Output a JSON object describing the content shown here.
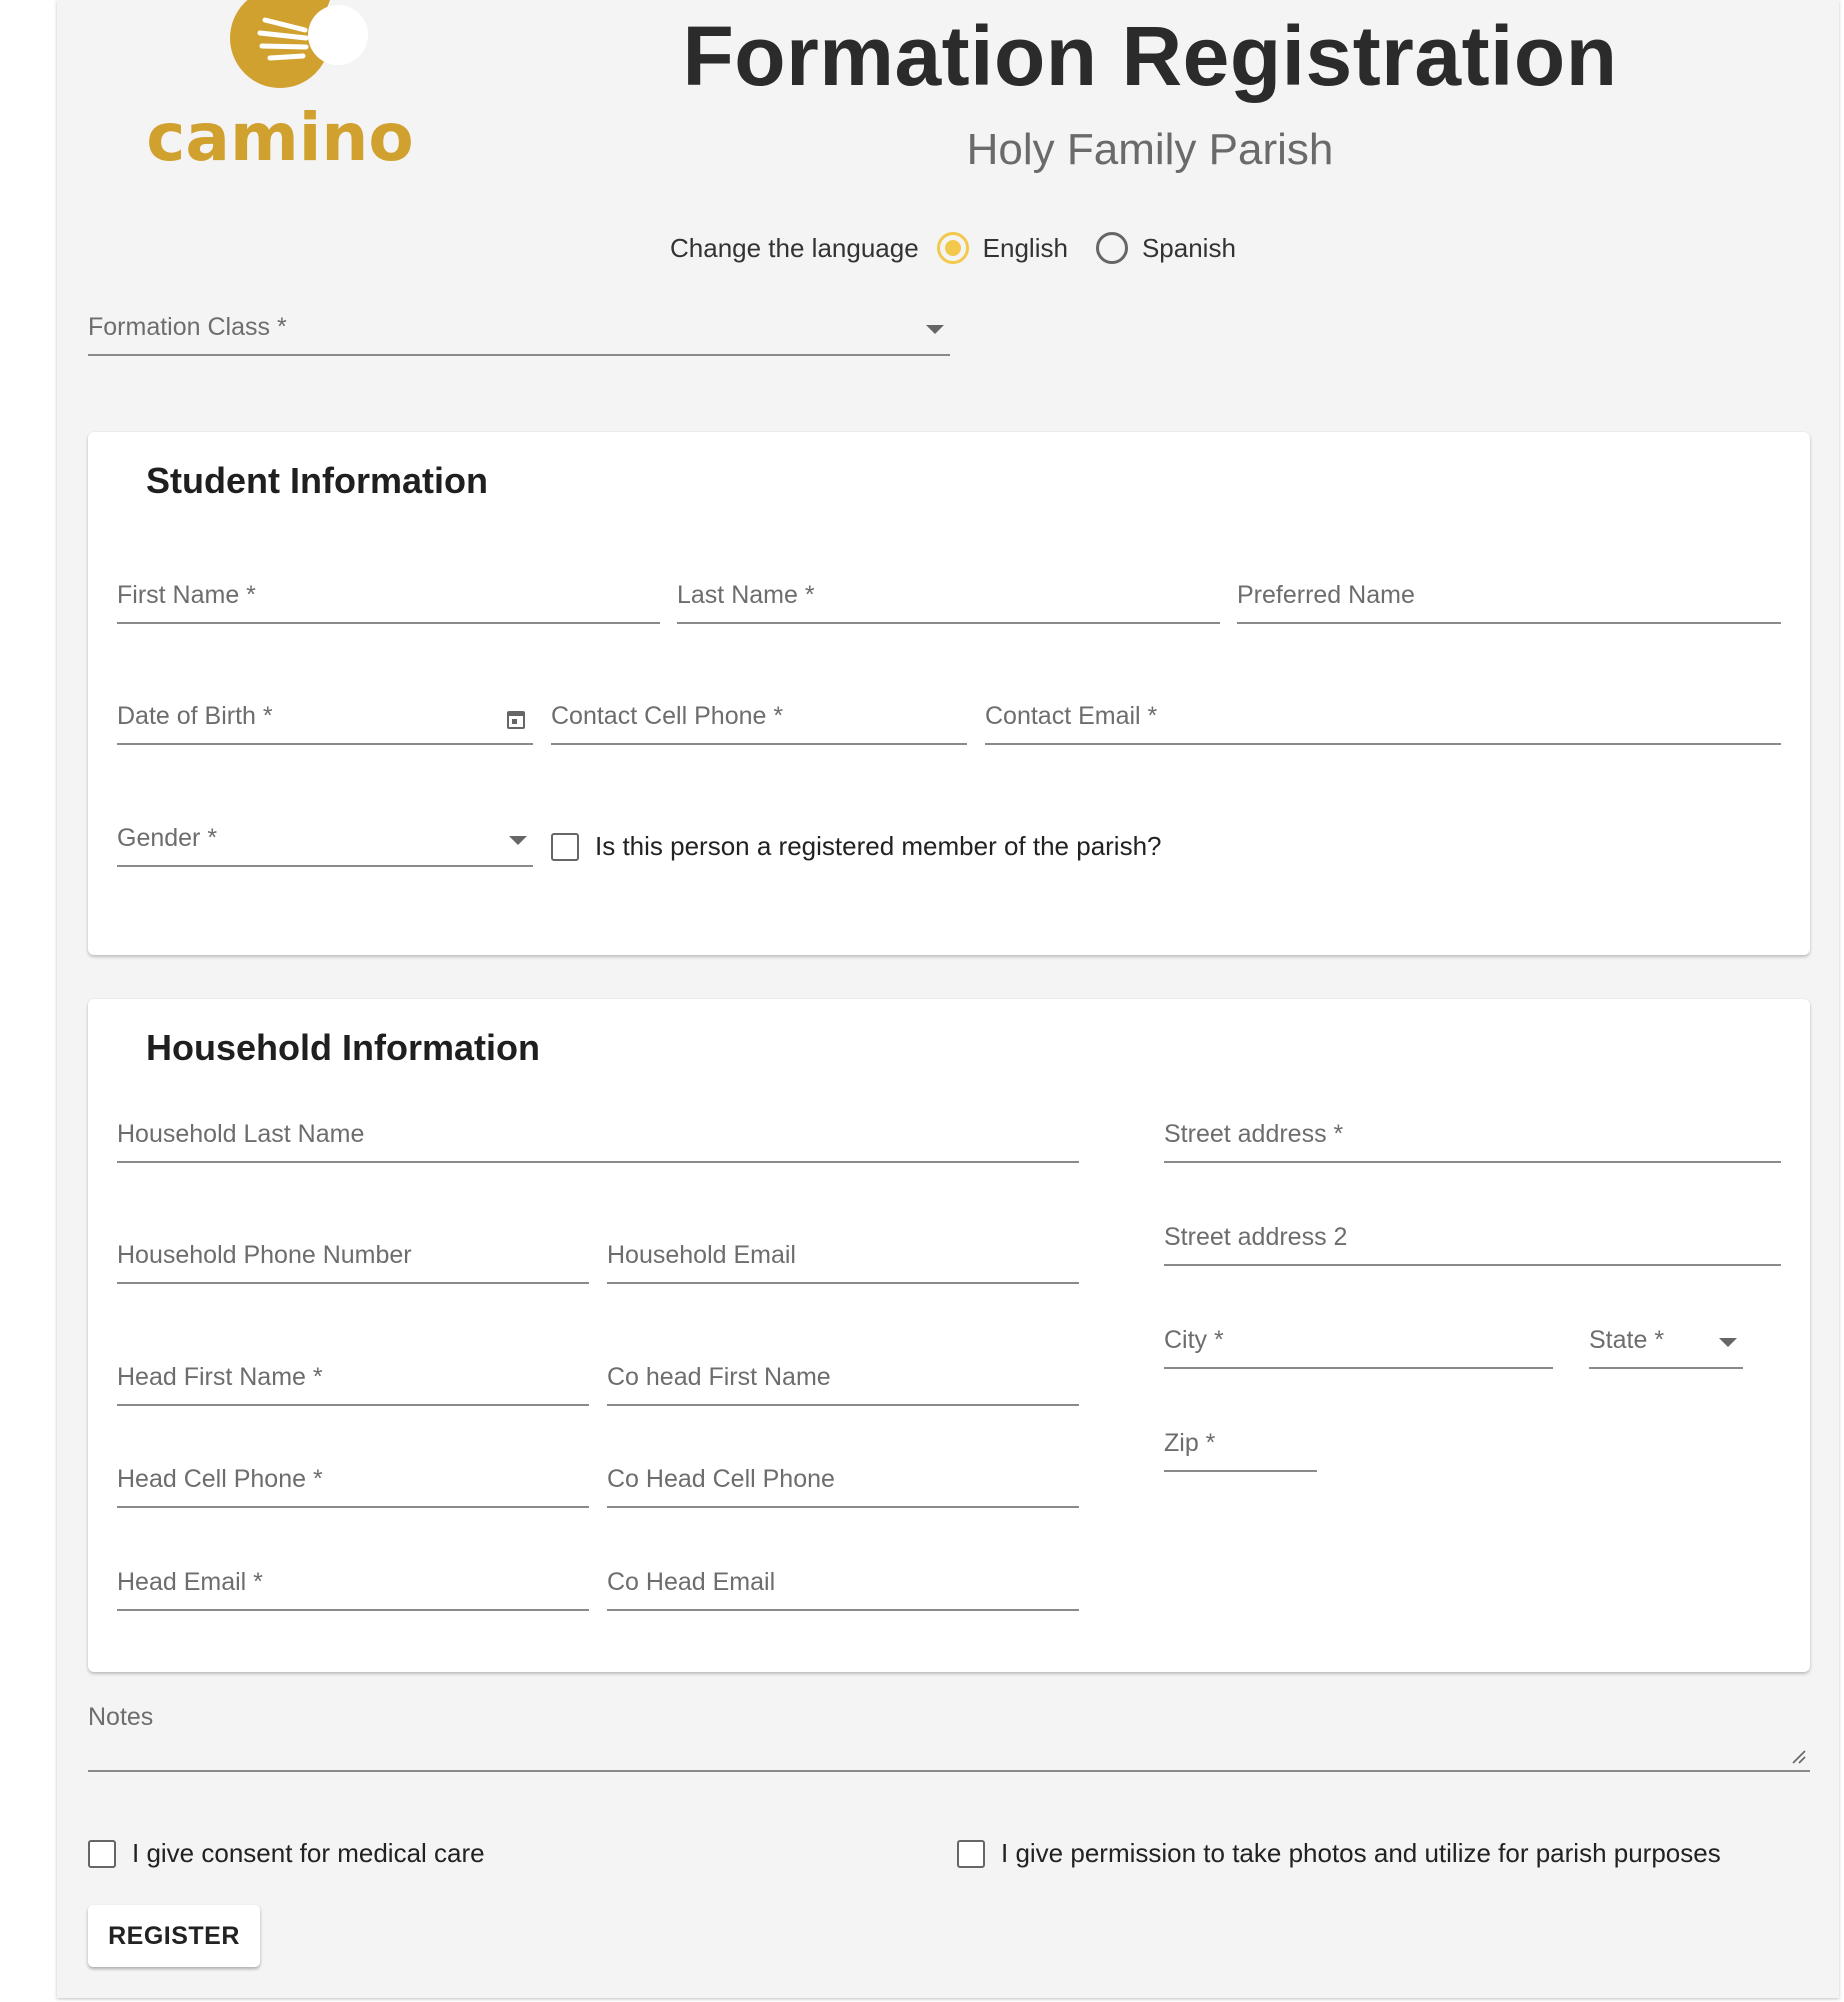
{
  "header": {
    "logo_text": "camino",
    "title": "Formation Registration",
    "subtitle": "Holy Family Parish",
    "brand_color": "#d0a12e"
  },
  "language": {
    "label": "Change the language",
    "options": [
      "English",
      "Spanish"
    ],
    "selected": "English",
    "accent_color": "#f2c94c"
  },
  "formation_class": {
    "label": "Formation Class *"
  },
  "student": {
    "title": "Student Information",
    "first_name": "First Name *",
    "last_name": "Last Name *",
    "preferred_name": "Preferred Name",
    "dob": "Date of Birth *",
    "cell_phone": "Contact Cell Phone *",
    "email": "Contact Email *",
    "gender": "Gender *",
    "registered_member": "Is this person a registered member of the parish?"
  },
  "household": {
    "title": "Household Information",
    "last_name": "Household Last Name",
    "phone": "Household Phone Number",
    "email": "Household Email",
    "head_first_name": "Head First Name *",
    "cohead_first_name": "Co head First Name",
    "head_cell_phone": "Head Cell Phone *",
    "cohead_cell_phone": "Co Head Cell Phone",
    "head_email": "Head Email *",
    "cohead_email": "Co Head Email",
    "street1": "Street address *",
    "street2": "Street address 2",
    "city": "City *",
    "state": "State *",
    "zip": "Zip *"
  },
  "notes": {
    "label": "Notes"
  },
  "consent": {
    "medical": "I give consent for medical care",
    "photos": "I give permission to take photos and utilize for parish purposes"
  },
  "actions": {
    "register": "REGISTER"
  }
}
